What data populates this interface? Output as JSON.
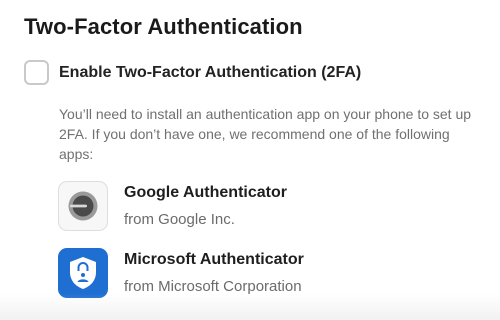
{
  "section": {
    "title": "Two-Factor Authentication"
  },
  "toggle": {
    "label": "Enable Two-Factor Authentication (2FA)",
    "checked": false
  },
  "description": "You’ll need to install an authentication app on your phone to set up 2FA. If you don’t have one, we recommend one of the following apps:",
  "apps": [
    {
      "name": "Google Authenticator",
      "vendor": "from Google Inc.",
      "icon": "google-authenticator-icon"
    },
    {
      "name": "Microsoft Authenticator",
      "vendor": "from Microsoft Corporation",
      "icon": "microsoft-authenticator-icon",
      "color": "#1f6fd3"
    }
  ]
}
